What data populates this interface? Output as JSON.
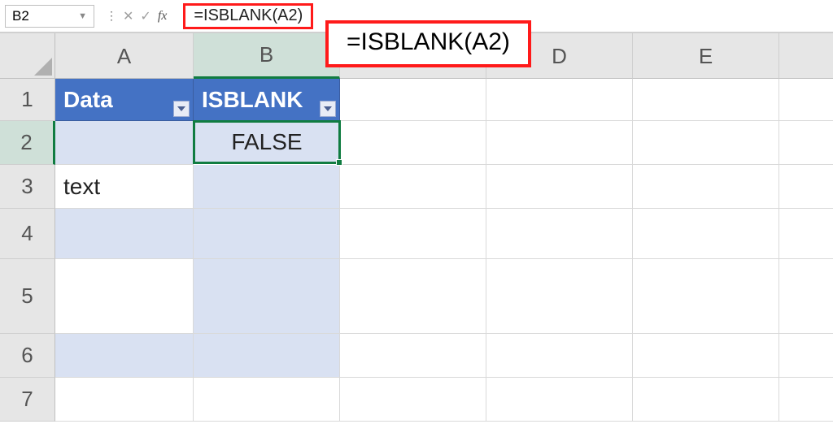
{
  "name_box": "B2",
  "formula": "=ISBLANK(A2)",
  "callout": "=ISBLANK(A2)",
  "columns": [
    "A",
    "B",
    "C",
    "D",
    "E"
  ],
  "rows": [
    "1",
    "2",
    "3",
    "4",
    "5",
    "6",
    "7"
  ],
  "table": {
    "headers": {
      "col_a": "Data",
      "col_b": "ISBLANK"
    },
    "rows": [
      {
        "a": "",
        "b": "FALSE",
        "striped": true,
        "selected_b": true
      },
      {
        "a": "text",
        "b": "",
        "striped": false
      },
      {
        "a": "",
        "b": "",
        "striped": true
      },
      {
        "a": "",
        "b": "",
        "striped": false
      },
      {
        "a": "",
        "b": "",
        "striped": true
      }
    ]
  },
  "selected_cell": "B2",
  "selected_col": "B",
  "selected_row": "2"
}
